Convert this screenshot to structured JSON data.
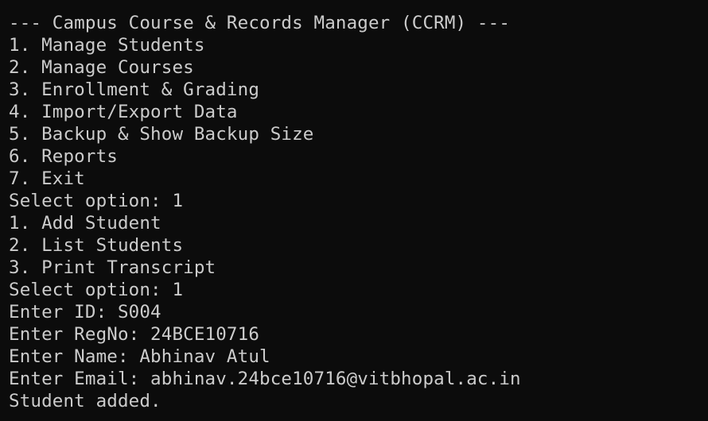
{
  "terminal": {
    "background": "#0c0c0c",
    "foreground": "#cccccc",
    "lines": [
      "--- Campus Course & Records Manager (CCRM) ---",
      "1. Manage Students",
      "2. Manage Courses",
      "3. Enrollment & Grading",
      "4. Import/Export Data",
      "5. Backup & Show Backup Size",
      "6. Reports",
      "7. Exit",
      "Select option: 1",
      "1. Add Student",
      "2. List Students",
      "3. Print Transcript",
      "Select option: 1",
      "Enter ID: S004",
      "Enter RegNo: 24BCE10716",
      "Enter Name: Abhinav Atul",
      "Enter Email: abhinav.24bce10716@vitbhopal.ac.in",
      "Student added."
    ]
  }
}
